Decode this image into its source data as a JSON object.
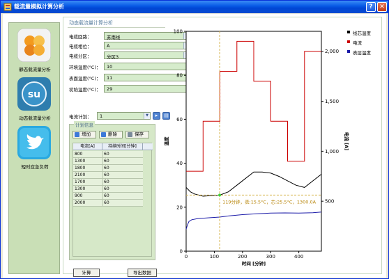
{
  "window": {
    "title": "载流量模拟计算分析",
    "help": "?",
    "close": "✕"
  },
  "sidebar": {
    "items": [
      {
        "label": "静态载流量分析",
        "icon": "orange-circles-icon"
      },
      {
        "label": "动态载流量分析",
        "icon": "stumbleupon-icon"
      },
      {
        "label": "短时应急负荷",
        "icon": "twitter-bird-icon"
      }
    ]
  },
  "panel": {
    "title": "动态载流量计算分析"
  },
  "form": {
    "circuit": {
      "label": "电缆回路：",
      "value": "苏南线"
    },
    "phase": {
      "label": "电缆相位：",
      "value": "A"
    },
    "section": {
      "label": "电缆分区：",
      "value": "分区3"
    },
    "env_temp": {
      "label": "环境温度(°C)：",
      "value": "10"
    },
    "surface_temp": {
      "label": "表面温度(°C)：",
      "value": "11"
    },
    "init_temp": {
      "label": "初始温度(°C)：",
      "value": "29"
    },
    "plan": {
      "label": "电流计划：",
      "value": "1"
    }
  },
  "plan_group": {
    "title": "计划信息",
    "add": "增加",
    "delete": "删除",
    "save": "保存",
    "columns": [
      "电流[A]",
      "持续时间[分钟]"
    ],
    "rows": [
      [
        "800",
        "60"
      ],
      [
        "1300",
        "60"
      ],
      [
        "1800",
        "60"
      ],
      [
        "2100",
        "60"
      ],
      [
        "1700",
        "60"
      ],
      [
        "1300",
        "60"
      ],
      [
        "900",
        "60"
      ],
      [
        "2000",
        "60"
      ]
    ]
  },
  "buttons": {
    "calculate": "计算",
    "export": "导出数据"
  },
  "colors": {
    "core": "#000000",
    "current": "#cc0000",
    "surface": "#1a1aa8",
    "cursor": "#d6b34a"
  },
  "chart_data": {
    "type": "line",
    "xlabel": "时间 [分钟]",
    "ylabel_left": "温度",
    "ylabel_right": "电流 [A]",
    "xlim": [
      0,
      480
    ],
    "ylim_left": [
      0,
      100
    ],
    "ylim_right": [
      0,
      2200
    ],
    "x_ticks": [
      0,
      100,
      200,
      300,
      400
    ],
    "y_ticks_left": [
      0,
      20,
      40,
      60,
      80,
      100
    ],
    "y_ticks_right": [
      "500",
      "1,000",
      "1,500",
      "2,000"
    ],
    "legend_position": "right",
    "annotation": "119分钟，表:15.5°C，芯:25.5°C，1300.0A",
    "cursor_x": 119,
    "series": [
      {
        "name": "线芯温度",
        "axis": "left",
        "x": [
          0,
          15,
          30,
          60,
          90,
          120,
          150,
          180,
          210,
          240,
          270,
          300,
          330,
          360,
          390,
          420,
          450,
          480
        ],
        "y": [
          29,
          27,
          26,
          25,
          25.3,
          25.5,
          27,
          30,
          33,
          36,
          36,
          35.5,
          34,
          32,
          30,
          29,
          32,
          35
        ]
      },
      {
        "name": "电流",
        "axis": "right",
        "x": [
          0,
          60,
          60,
          120,
          120,
          180,
          180,
          240,
          240,
          300,
          300,
          360,
          360,
          420,
          420,
          480
        ],
        "y": [
          800,
          800,
          1300,
          1300,
          1800,
          1800,
          2100,
          2100,
          1700,
          1700,
          1300,
          1300,
          900,
          900,
          2000,
          2000
        ]
      },
      {
        "name": "表层温度",
        "axis": "left",
        "x": [
          0,
          5,
          10,
          20,
          40,
          60,
          90,
          119,
          150,
          200,
          250,
          300,
          350,
          400,
          450,
          480
        ],
        "y": [
          10,
          12,
          13.5,
          14.3,
          14.8,
          15,
          15.3,
          15.5,
          16,
          16.6,
          17,
          17.3,
          17.4,
          17.3,
          17.5,
          17.8
        ]
      }
    ]
  }
}
